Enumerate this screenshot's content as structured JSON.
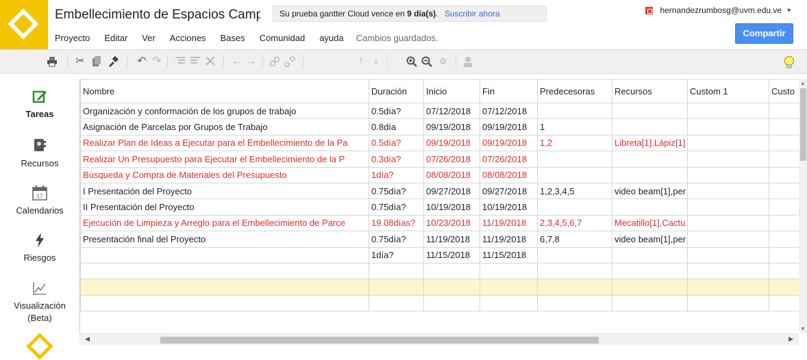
{
  "header": {
    "title": "Embellecimiento de Espacios Campestres",
    "trial_text": "Su prueba gantter Cloud vence en",
    "trial_days": "9 día(s)",
    "trial_period": ".",
    "subscribe_label": "Suscribir ahora",
    "user_email": "hernandezrumbosg@uvm.edu.ve",
    "share_label": "Compartir",
    "menu": [
      "Proyecto",
      "Editar",
      "Ver",
      "Acciones",
      "Bases",
      "Comunidad",
      "ayuda"
    ],
    "saved_status": "Cambios guardados."
  },
  "toolbar": {
    "icons": [
      "print-icon",
      "cut-icon",
      "copy-icon",
      "format-painter-icon",
      "undo-icon",
      "redo-icon",
      "indent-icon",
      "outdent-icon",
      "delete-icon",
      "left-arrow-icon",
      "right-arrow-icon",
      "link-icon",
      "unlink-icon",
      "up-arrow-icon",
      "down-arrow-icon",
      "zoom-in-icon",
      "zoom-out-icon",
      "settings-icon",
      "user-icon",
      "lightbulb-icon"
    ]
  },
  "sidebar": {
    "items": [
      {
        "label": "Tareas",
        "icon": "edit-task-icon"
      },
      {
        "label": "Recursos",
        "icon": "resources-icon"
      },
      {
        "label": "Calendarios",
        "icon": "calendar-icon",
        "badge": "17"
      },
      {
        "label": "Riesgos",
        "icon": "lightning-icon"
      },
      {
        "label": "Visualización",
        "sub": "(Beta)",
        "icon": "chart-icon"
      }
    ],
    "active": "Tareas"
  },
  "grid": {
    "columns": [
      "Nombre",
      "Duración",
      "Inicio",
      "Fin",
      "Predecesoras",
      "Recursos",
      "Custom 1",
      "Custo"
    ],
    "rows": [
      {
        "name": "Organización y conformación de los grupos de trabajo",
        "duration": "0.5día?",
        "start": "07/12/2018",
        "end": "07/12/2018",
        "pred": "",
        "res": "",
        "c1": "",
        "c2": "",
        "red": false
      },
      {
        "name": "Asignación de Parcelas por Grupos de Trabajo",
        "duration": "0.8día",
        "start": "09/19/2018",
        "end": "09/19/2018",
        "pred": "1",
        "res": "",
        "c1": "",
        "c2": "",
        "red": false
      },
      {
        "name": "Realizar Plan de Ideas a Ejecutar para el Embellecimiento de la Pa",
        "duration": "0.5día?",
        "start": "09/19/2018",
        "end": "09/19/2018",
        "pred": "1,2",
        "res": "Libreta[1],Lápiz[1]",
        "c1": "",
        "c2": "",
        "red": true
      },
      {
        "name": "Realizar Un Presupuesto para Ejecutar el Embellecimiento de la P",
        "duration": "0.3día?",
        "start": "07/26/2018",
        "end": "07/26/2018",
        "pred": "",
        "res": "",
        "c1": "",
        "c2": "",
        "red": true
      },
      {
        "name": "Búsqueda y Compra de Materiales del Presupuesto",
        "duration": "1día?",
        "start": "08/08/2018",
        "end": "08/08/2018",
        "pred": "",
        "res": "",
        "c1": "",
        "c2": "",
        "red": true
      },
      {
        "name": "I Presentación del Proyecto",
        "duration": "0.75día?",
        "start": "09/27/2018",
        "end": "09/27/2018",
        "pred": "1,2,3,4,5",
        "res": "video beam[1],per",
        "c1": "",
        "c2": "",
        "red": false
      },
      {
        "name": "II Presentación del Proyecto",
        "duration": "0.75día?",
        "start": "10/19/2018",
        "end": "10/19/2018",
        "pred": "",
        "res": "",
        "c1": "",
        "c2": "",
        "red": false
      },
      {
        "name": "Ejecución de Limpieza y Arreglo para el Embellecimiento de Parce",
        "duration": "19.08días?",
        "start": "10/23/2018",
        "end": "11/19/2018",
        "pred": "2,3,4,5,6,7",
        "res": "Mecatillo[1],Cactu",
        "c1": "",
        "c2": "",
        "red": true
      },
      {
        "name": "Presentación final del Proyecto",
        "duration": "0.75día?",
        "start": "11/19/2018",
        "end": "11/19/2018",
        "pred": "6,7,8",
        "res": "video beam[1],per",
        "c1": "",
        "c2": "",
        "red": false
      },
      {
        "name": "",
        "duration": "1día?",
        "start": "11/15/2018",
        "end": "11/15/2018",
        "pred": "",
        "res": "",
        "c1": "",
        "c2": "",
        "red": false
      },
      {
        "name": "",
        "duration": "",
        "start": "",
        "end": "",
        "pred": "",
        "res": "",
        "c1": "",
        "c2": "",
        "red": false
      },
      {
        "name": "",
        "duration": "",
        "start": "",
        "end": "",
        "pred": "",
        "res": "",
        "c1": "",
        "c2": "",
        "red": false,
        "highlight": true
      },
      {
        "name": "",
        "duration": "",
        "start": "",
        "end": "",
        "pred": "",
        "res": "",
        "c1": "",
        "c2": "",
        "red": false
      }
    ]
  },
  "colors": {
    "brand": "#f4c400",
    "share": "#4a8ef1",
    "critical_text": "#e02c2c",
    "selected_row": "#fbf7cd",
    "link": "#3a67c9"
  }
}
